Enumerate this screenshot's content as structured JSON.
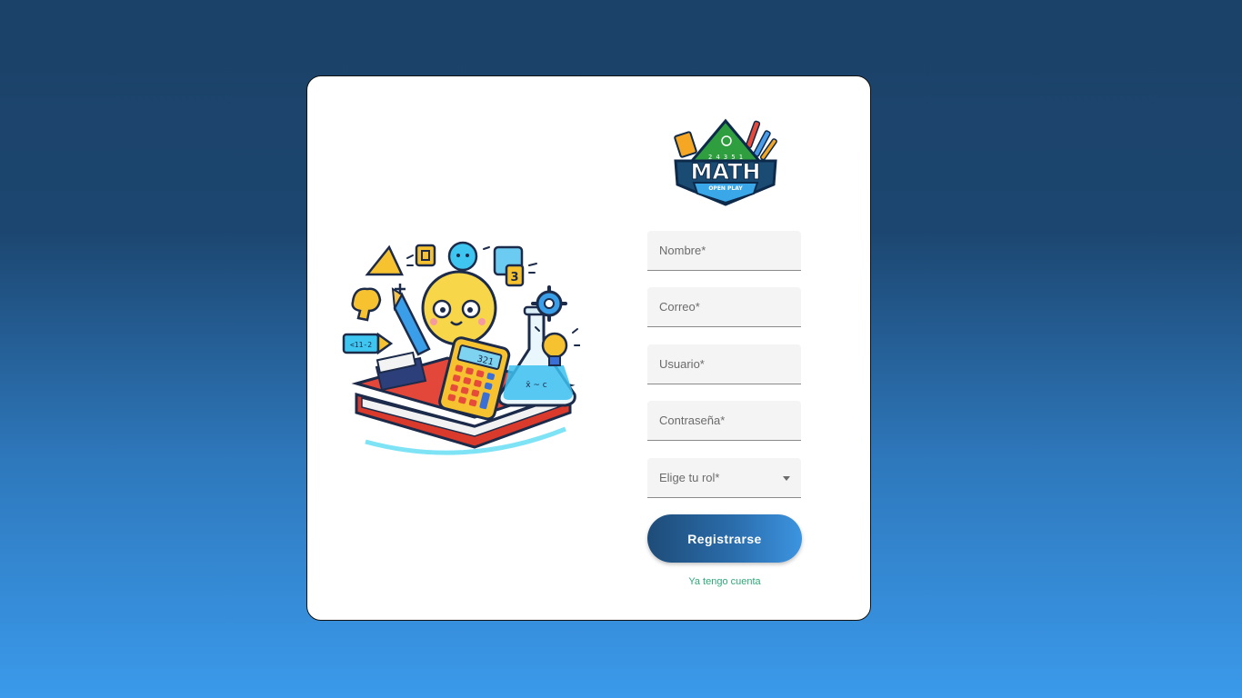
{
  "illustration": {
    "calculator_display": "321",
    "block_number": "3",
    "tag_text": "<11-2"
  },
  "logo": {
    "title": "MATH",
    "subtitle": "OPEN PLAY",
    "top_digits": "2 4 3 5 1"
  },
  "form": {
    "nombre_placeholder": "Nombre*",
    "correo_placeholder": "Correo*",
    "usuario_placeholder": "Usuario*",
    "contrasena_placeholder": "Contraseña*",
    "rol_label": "Elige tu rol*",
    "submit_label": "Registrarse",
    "login_link": "Ya tengo cuenta"
  },
  "colors": {
    "background_top": "#1b4268",
    "background_bottom": "#3b9aeb",
    "button": "#2a6cab",
    "link": "#2fa87a"
  }
}
